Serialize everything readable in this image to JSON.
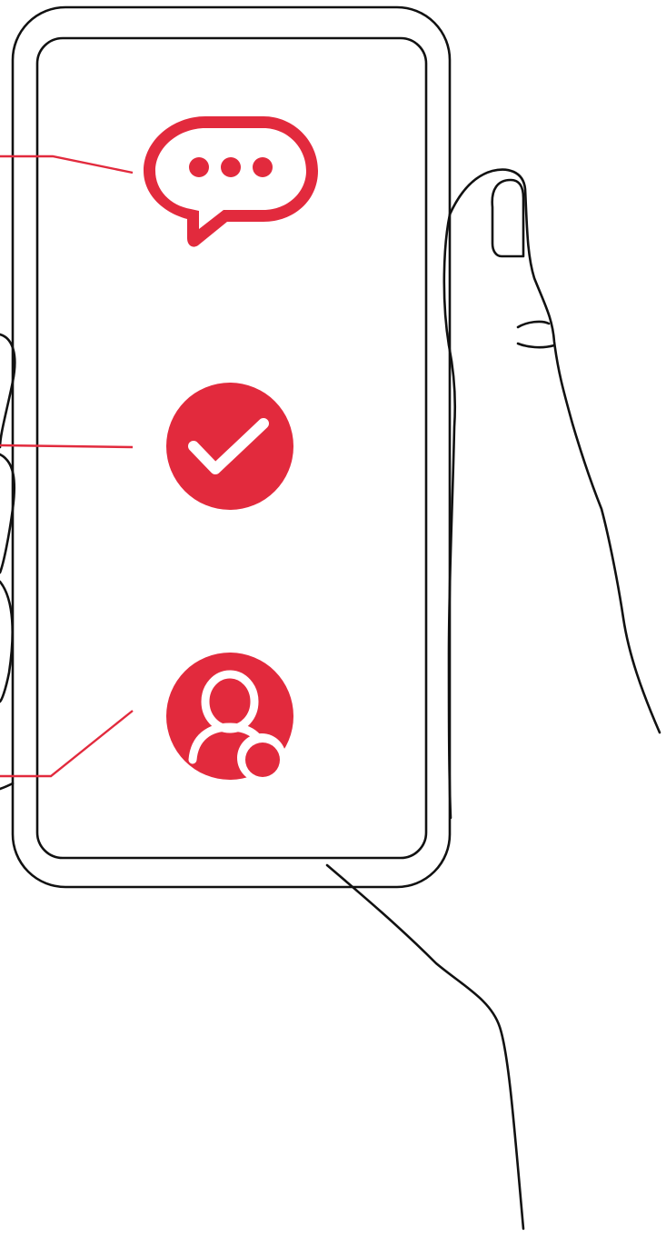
{
  "colors": {
    "accent": "#E22A3D",
    "outline": "#111111",
    "background": "#FFFFFF"
  },
  "phone": {
    "icons": [
      {
        "name": "chat-bubble-icon"
      },
      {
        "name": "checkmark-circle-icon"
      },
      {
        "name": "user-notification-icon"
      }
    ]
  }
}
